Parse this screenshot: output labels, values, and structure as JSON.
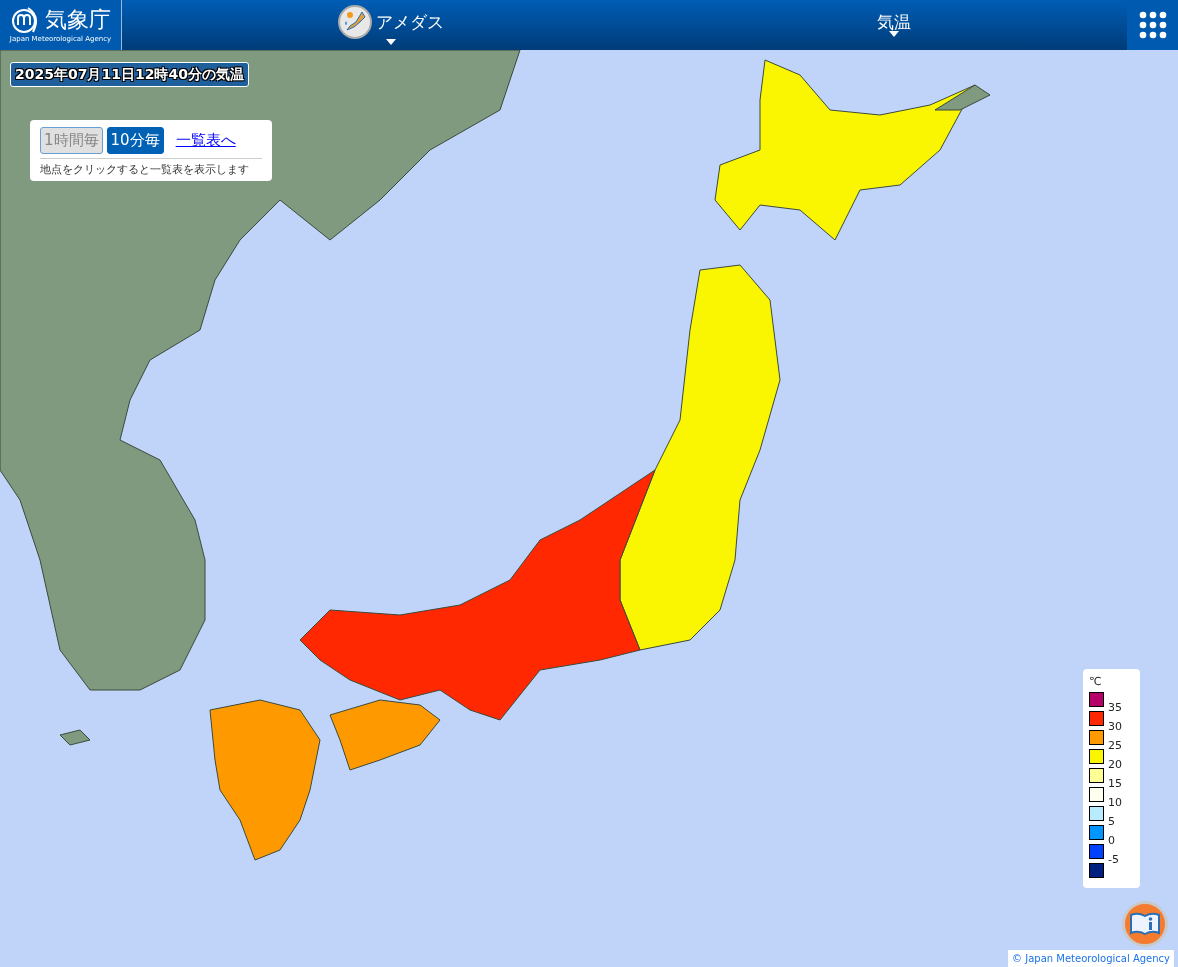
{
  "header": {
    "logo_text": "気象庁",
    "logo_subtext": "Japan Meteorological Agency",
    "menus": [
      {
        "label": "アメダス",
        "kind": "amedas"
      },
      {
        "label": "気温",
        "kind": "plain"
      }
    ]
  },
  "map": {
    "title": "2025年07月11日12時40分の気温",
    "controls": {
      "intervals": [
        {
          "label": "1時間毎",
          "selected": false
        },
        {
          "label": "10分毎",
          "selected": true
        }
      ],
      "list_link": "一覧表へ",
      "hint": "地点をクリックすると一覧表を表示します"
    },
    "legend": {
      "unit": "℃",
      "swatches": [
        {
          "color": "#b40068"
        },
        {
          "color": "#ff2800"
        },
        {
          "color": "#ff9900"
        },
        {
          "color": "#faf500"
        },
        {
          "color": "#ffff96"
        },
        {
          "color": "#fffff0"
        },
        {
          "color": "#b9ebff"
        },
        {
          "color": "#0096ff"
        },
        {
          "color": "#0041ff"
        },
        {
          "color": "#002080"
        }
      ],
      "labels": [
        "35",
        "30",
        "25",
        "20",
        "15",
        "10",
        "5",
        "0",
        "-5"
      ]
    },
    "copyright": "© Japan Meteorological Agency"
  }
}
